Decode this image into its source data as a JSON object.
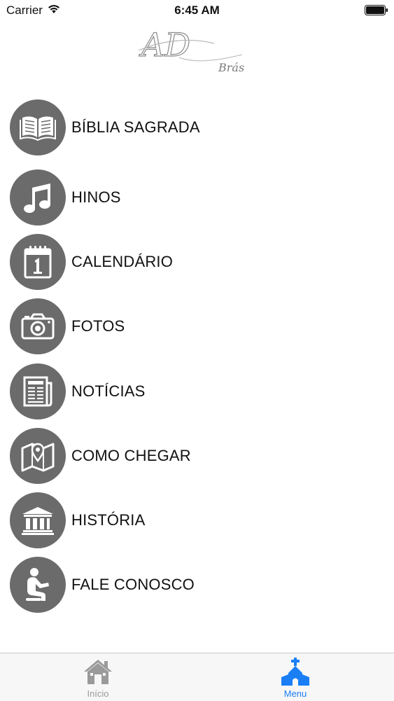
{
  "status_bar": {
    "carrier": "Carrier",
    "time": "6:45 AM",
    "icons": [
      "wifi-icon",
      "battery-icon"
    ]
  },
  "logo": {
    "letters": "AD",
    "subtitle": "Brás"
  },
  "menu": {
    "items": [
      {
        "label": "BÍBLIA SAGRADA",
        "icon": "bible-icon"
      },
      {
        "label": "HINOS",
        "icon": "music-note-icon"
      },
      {
        "label": "CALENDÁRIO",
        "icon": "calendar-icon"
      },
      {
        "label": "FOTOS",
        "icon": "camera-icon"
      },
      {
        "label": "NOTÍCIAS",
        "icon": "newspaper-icon"
      },
      {
        "label": "COMO CHEGAR",
        "icon": "map-pin-icon"
      },
      {
        "label": "HISTÓRIA",
        "icon": "museum-icon"
      },
      {
        "label": "FALE CONOSCO",
        "icon": "praying-person-icon"
      }
    ]
  },
  "tab_bar": {
    "tabs": [
      {
        "label": "Início",
        "icon": "home-icon",
        "selected": false
      },
      {
        "label": "Menu",
        "icon": "church-icon",
        "selected": true
      }
    ]
  },
  "colors": {
    "icon_circle": "#6b6b6b",
    "tab_active": "#1a7ef5",
    "tab_inactive": "#9a9a9a"
  }
}
